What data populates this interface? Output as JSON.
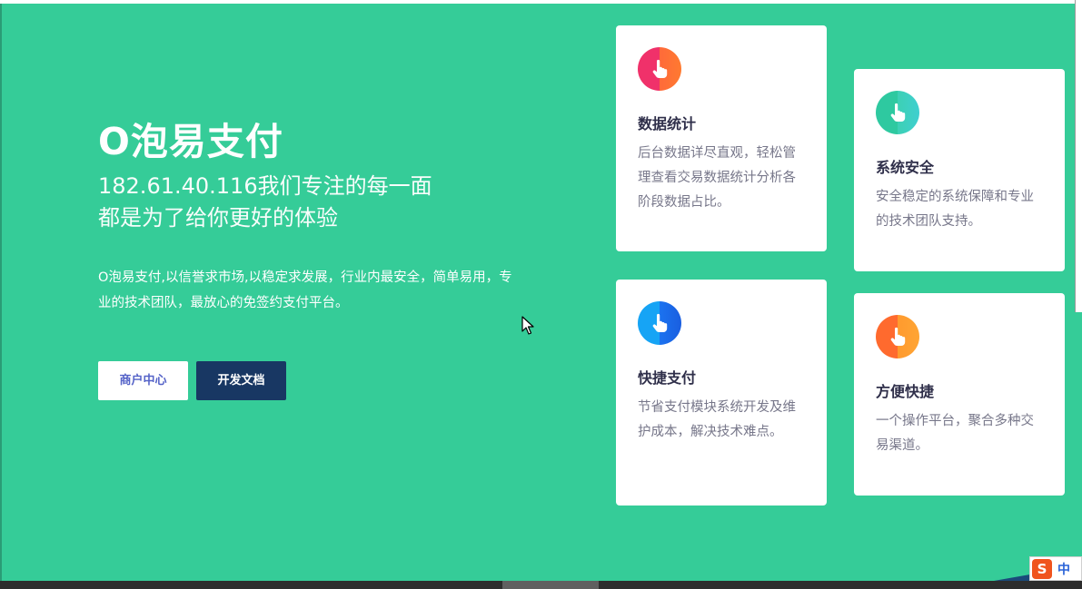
{
  "hero": {
    "title": "O泡易支付",
    "subtitle_line1": "182.61.40.116我们专注的每一面",
    "subtitle_line2": "都是为了给你更好的体验",
    "description": "O泡易支付,以信誉求市场,以稳定求发展，行业内最安全，简单易用，专业的技术团队，最放心的免签约支付平台。"
  },
  "buttons": {
    "merchant_center": "商户中心",
    "dev_docs": "开发文档"
  },
  "cards": [
    {
      "title": "数据统计",
      "text": "后台数据详尽直观，轻松管理查看交易数据统计分析各阶段数据占比。",
      "icon": "hand-pointer-icon",
      "color": "#f0316a"
    },
    {
      "title": "系统安全",
      "text": "安全稳定的系统保障和专业的技术团队支持。",
      "icon": "hand-pointer-icon",
      "color": "#2ec9a0"
    },
    {
      "title": "快捷支付",
      "text": "节省支付模块系统开发及维护成本，解决技术难点。",
      "icon": "hand-pointer-icon",
      "color": "#16a4f5"
    },
    {
      "title": "方便快捷",
      "text": "一个操作平台，聚合多种交易渠道。",
      "icon": "hand-pointer-icon",
      "color": "#ff6a2e"
    }
  ],
  "ime": {
    "logo": "S",
    "mode": "中"
  },
  "colors": {
    "background": "#35cc98",
    "docs_button": "#183763",
    "merchant_text": "#5563c8"
  }
}
